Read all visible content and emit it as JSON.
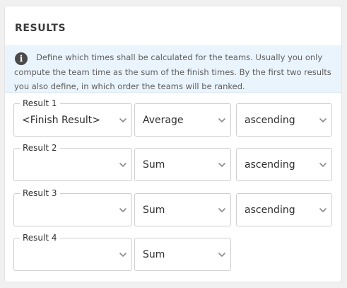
{
  "section": {
    "title": "RESULTS",
    "info_icon": "info-icon",
    "info_text": "Define which times shall be calculated for the teams. Usually you only compute the team time as the sum of the finish times. By the first two results you also define, in which order the teams will be ranked."
  },
  "results": [
    {
      "label": "Result 1",
      "value": "<Finish Result>",
      "aggregate": "Average",
      "order": "ascending"
    },
    {
      "label": "Result 2",
      "value": "",
      "aggregate": "Sum",
      "order": "ascending"
    },
    {
      "label": "Result 3",
      "value": "",
      "aggregate": "Sum",
      "order": "ascending"
    },
    {
      "label": "Result 4",
      "value": "",
      "aggregate": "Sum"
    }
  ],
  "chevron_icon": "chevron-down-icon"
}
